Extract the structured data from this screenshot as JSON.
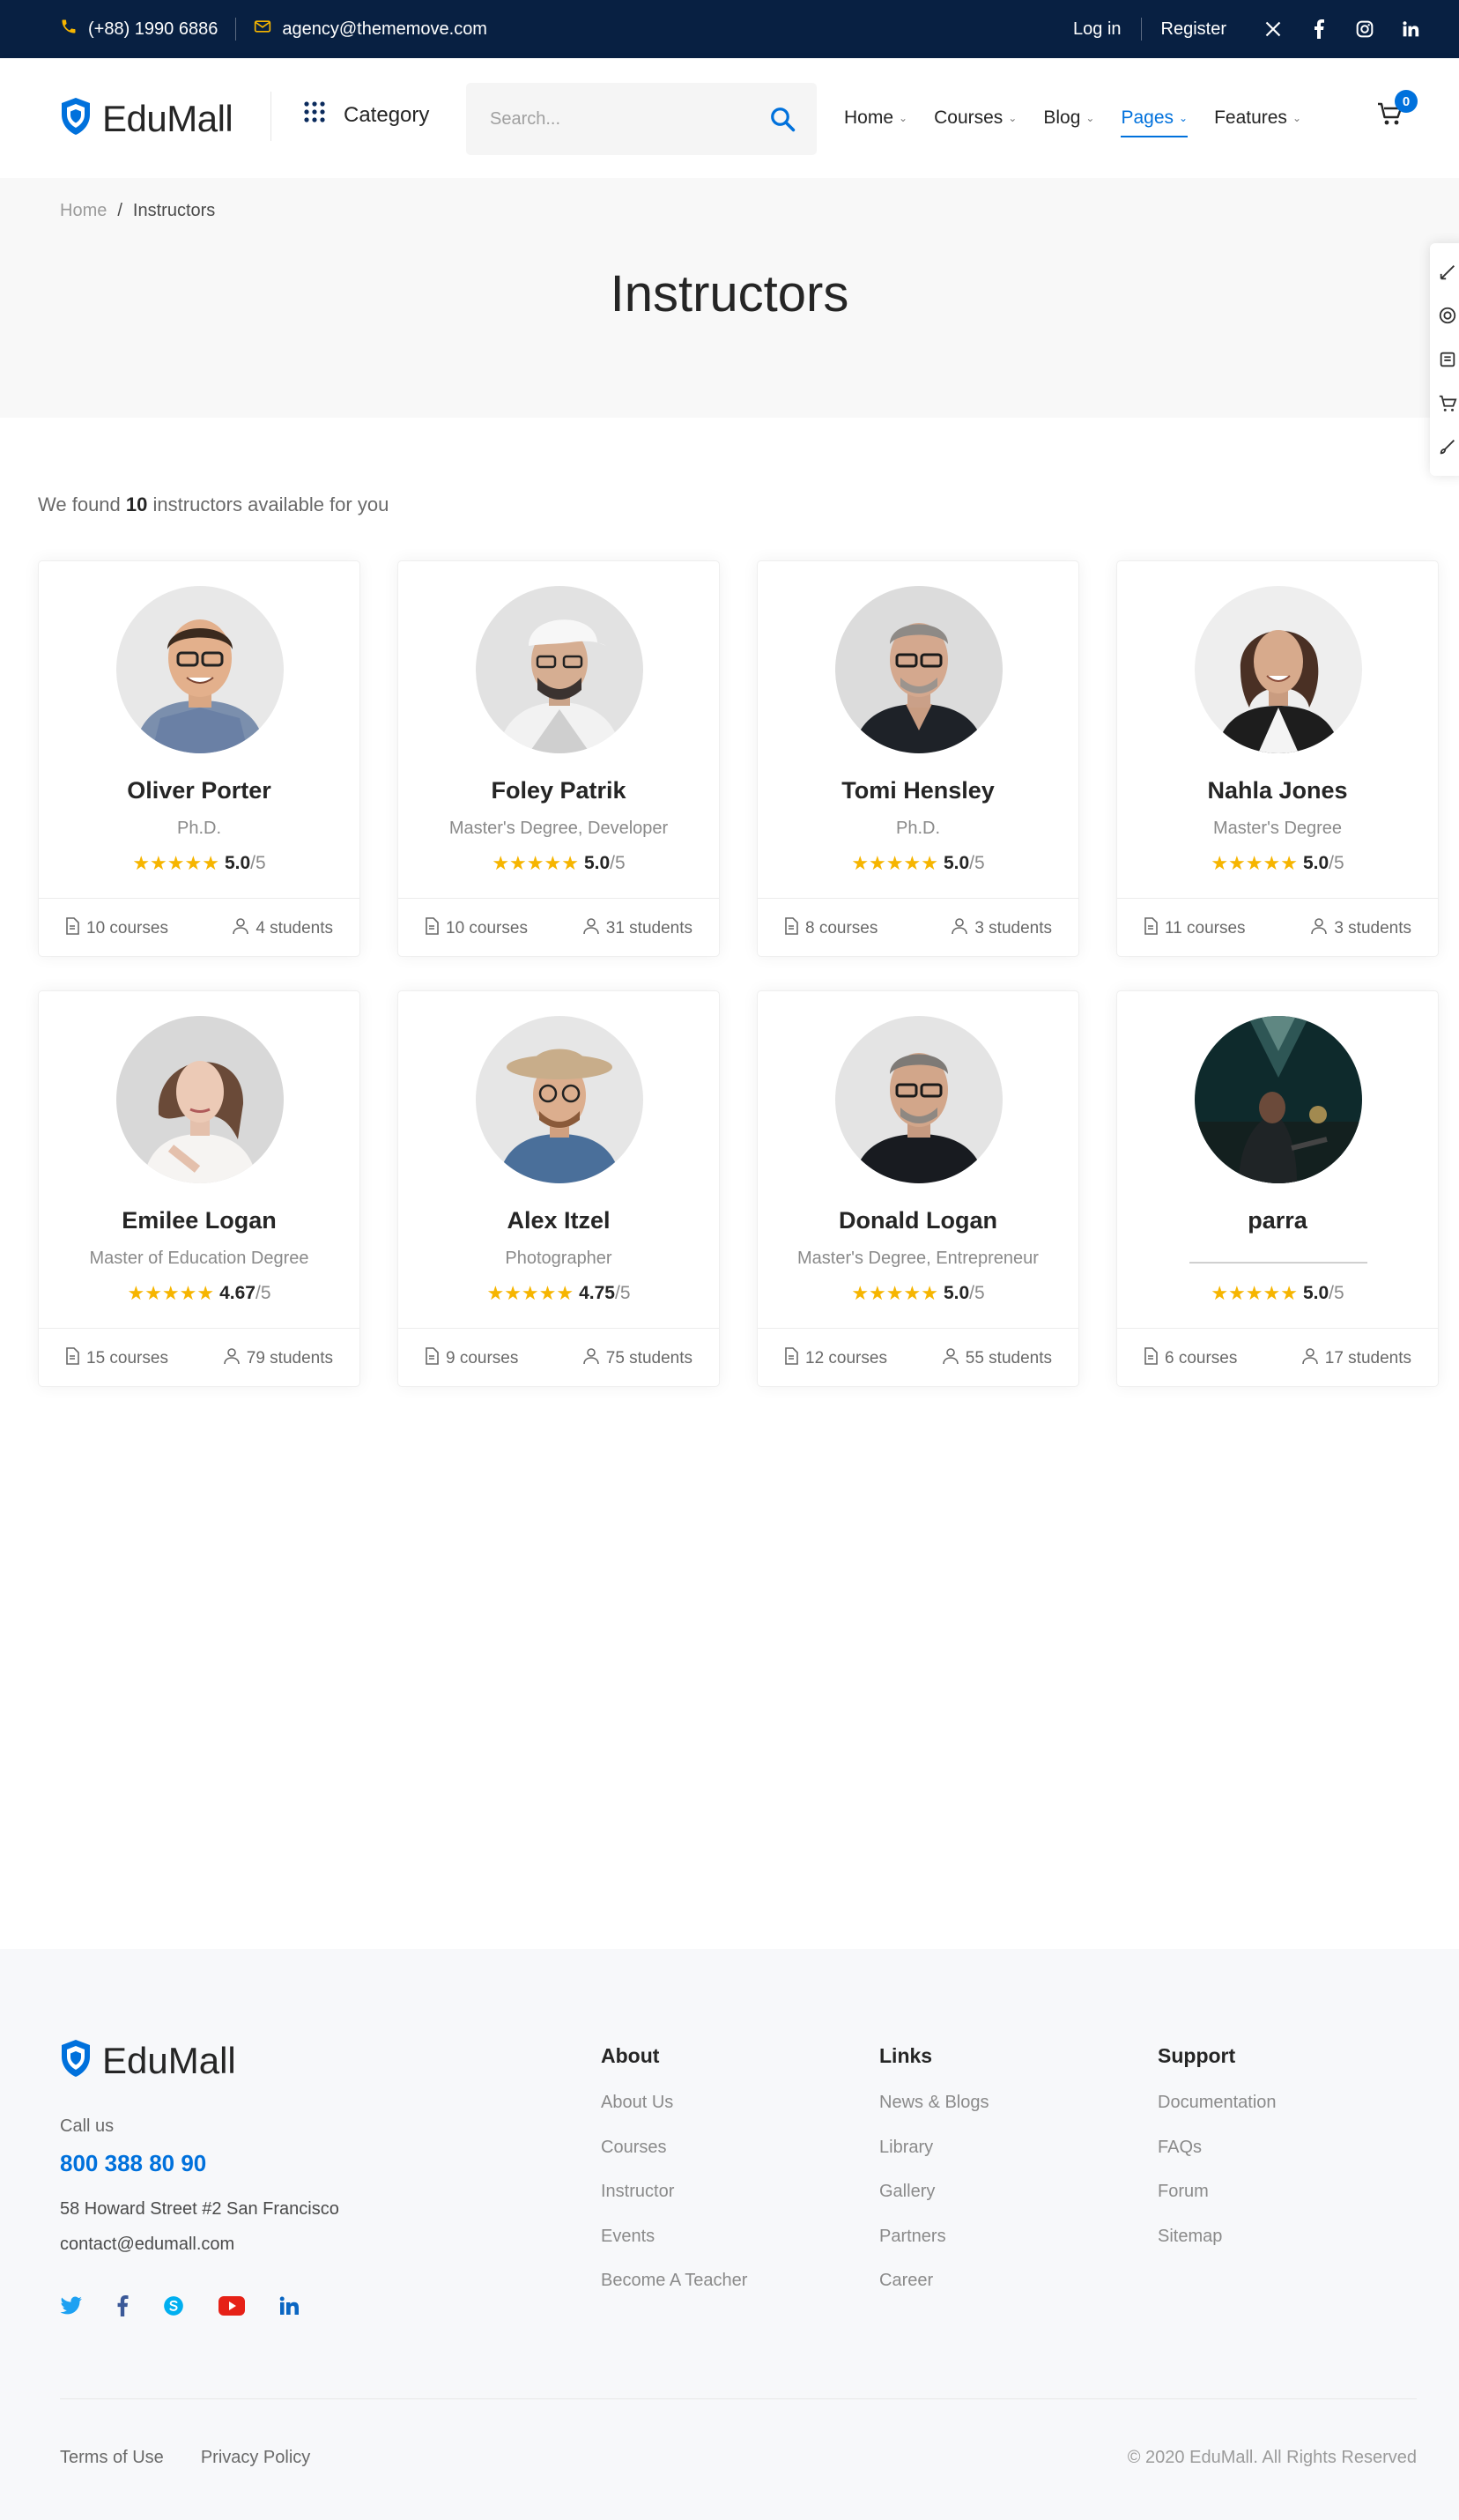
{
  "topbar": {
    "phone": "(+88) 1990 6886",
    "email": "agency@thememove.com",
    "login": "Log in",
    "register": "Register",
    "social_icons": [
      "x-icon",
      "facebook-icon",
      "instagram-icon",
      "linkedin-icon"
    ]
  },
  "header": {
    "brand": "EduMall",
    "category_label": "Category",
    "search_placeholder": "Search...",
    "nav": [
      {
        "label": "Home"
      },
      {
        "label": "Courses"
      },
      {
        "label": "Blog"
      },
      {
        "label": "Pages",
        "active": true
      },
      {
        "label": "Features"
      }
    ],
    "cart_count": "0",
    "accent_color": "#0071dc"
  },
  "breadcrumb": {
    "home": "Home",
    "separator": "/",
    "current": "Instructors"
  },
  "page_title": "Instructors",
  "results": {
    "prefix": "We found",
    "count": "10",
    "suffix": "instructors available for you"
  },
  "instructors": [
    {
      "name": "Oliver Porter",
      "degree": "Ph.D.",
      "rating": "5.0",
      "rating_max": "/5",
      "stars": "★★★★★",
      "courses": "10 courses",
      "students": "4 students"
    },
    {
      "name": "Foley Patrik",
      "degree": "Master's Degree, Developer",
      "rating": "5.0",
      "rating_max": "/5",
      "stars": "★★★★★",
      "courses": "10 courses",
      "students": "31 students"
    },
    {
      "name": "Tomi Hensley",
      "degree": "Ph.D.",
      "rating": "5.0",
      "rating_max": "/5",
      "stars": "★★★★★",
      "courses": "8 courses",
      "students": "3 students"
    },
    {
      "name": "Nahla Jones",
      "degree": "Master's Degree",
      "rating": "5.0",
      "rating_max": "/5",
      "stars": "★★★★★",
      "courses": "11 courses",
      "students": "3 students"
    },
    {
      "name": "Emilee Logan",
      "degree": "Master of Education Degree",
      "rating": "4.67",
      "rating_max": "/5",
      "stars": "★★★★★",
      "courses": "15 courses",
      "students": "79 students"
    },
    {
      "name": "Alex Itzel",
      "degree": "Photographer",
      "rating": "4.75",
      "rating_max": "/5",
      "stars": "★★★★★",
      "courses": "9 courses",
      "students": "75 students"
    },
    {
      "name": "Donald Logan",
      "degree": "Master's Degree, Entrepreneur",
      "rating": "5.0",
      "rating_max": "/5",
      "stars": "★★★★★",
      "courses": "12 courses",
      "students": "55 students"
    },
    {
      "name": "parra",
      "degree": "",
      "rating": "5.0",
      "rating_max": "/5",
      "stars": "★★★★★",
      "courses": "6 courses",
      "students": "17 students"
    }
  ],
  "footer": {
    "brand": "EduMall",
    "call_us": "Call us",
    "phone": "800 388 80 90",
    "address": "58 Howard Street #2 San Francisco",
    "email": "contact@edumall.com",
    "social_icons": [
      "twitter-icon",
      "facebook-icon",
      "skype-icon",
      "youtube-icon",
      "linkedin-icon"
    ],
    "about": {
      "title": "About",
      "links": [
        "About Us",
        "Courses",
        "Instructor",
        "Events",
        "Become A Teacher"
      ]
    },
    "links": {
      "title": "Links",
      "links": [
        "News & Blogs",
        "Library",
        "Gallery",
        "Partners",
        "Career"
      ]
    },
    "support": {
      "title": "Support",
      "links": [
        "Documentation",
        "FAQs",
        "Forum",
        "Sitemap"
      ]
    },
    "terms": "Terms of Use",
    "privacy": "Privacy Policy",
    "copyright": "© 2020 EduMall. All Rights Reserved"
  }
}
